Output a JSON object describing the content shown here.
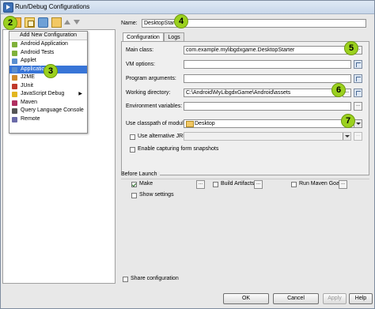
{
  "window": {
    "title": "Run/Debug Configurations"
  },
  "toolbar": {
    "icons": [
      "add-icon",
      "copy-icon",
      "edit-defaults-icon",
      "folder-icon",
      "move-up-icon",
      "move-down-icon"
    ]
  },
  "badges": {
    "b2": "2",
    "b3": "3",
    "b4": "4",
    "b5": "5",
    "b6": "6",
    "b7": "7"
  },
  "popup": {
    "header": "Add New Configuration",
    "items": [
      {
        "label": "Android Application",
        "icon": "android-icon",
        "color": "#7fb13a"
      },
      {
        "label": "Android Tests",
        "icon": "android-icon",
        "color": "#7fb13a"
      },
      {
        "label": "Applet",
        "icon": "applet-icon",
        "color": "#5a8fd0"
      },
      {
        "label": "Application",
        "icon": "application-icon",
        "color": "#5a8fd0",
        "selected": true
      },
      {
        "label": "J2ME",
        "icon": "j2me-icon",
        "color": "#d08a2a"
      },
      {
        "label": "JUnit",
        "icon": "junit-icon",
        "color": "#c0392b"
      },
      {
        "label": "JavaScript Debug",
        "icon": "javascript-icon",
        "color": "#e2b620",
        "submenu": true
      },
      {
        "label": "Maven",
        "icon": "maven-icon",
        "color": "#b03060"
      },
      {
        "label": "Query Language Console",
        "icon": "console-icon",
        "color": "#555555"
      },
      {
        "label": "Remote",
        "icon": "remote-icon",
        "color": "#6a6aa8"
      }
    ]
  },
  "name": {
    "label": "Name:",
    "value": "DesktopStarter"
  },
  "tabs": [
    {
      "label": "Configuration",
      "active": true
    },
    {
      "label": "Logs",
      "active": false
    }
  ],
  "config": {
    "main_class": {
      "label": "Main class:",
      "value": "com.example.mylibgdxgame.DesktopStarter"
    },
    "vm_options": {
      "label": "VM options:",
      "value": ""
    },
    "program_args": {
      "label": "Program arguments:",
      "value": ""
    },
    "working_dir": {
      "label": "Working directory:",
      "value": "C:\\Android\\MyLibgdxGame\\Android\\assets"
    },
    "env_vars": {
      "label": "Environment variables:",
      "value": ""
    },
    "classpath": {
      "label": "Use classpath of module:",
      "value": "Desktop"
    },
    "alt_jre": {
      "label": "Use alternative JRE:",
      "checked": false
    },
    "form_snapshots": {
      "label": "Enable capturing form snapshots",
      "checked": false
    }
  },
  "before_launch": {
    "title": "Before Launch",
    "make": {
      "label": "Make",
      "checked": true
    },
    "build_artifacts": {
      "label": "Build Artifacts",
      "checked": false
    },
    "run_maven": {
      "label": "Run Maven Goal",
      "checked": false
    },
    "show_settings": {
      "label": "Show settings",
      "checked": false
    }
  },
  "share": {
    "label": "Share configuration",
    "checked": false
  },
  "buttons": {
    "ok": "OK",
    "cancel": "Cancel",
    "apply": "Apply",
    "help": "Help"
  }
}
